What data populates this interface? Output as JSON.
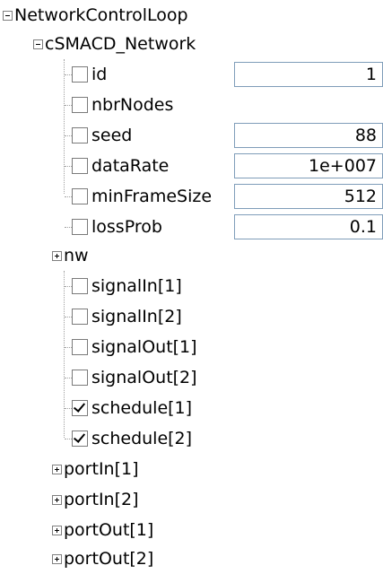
{
  "tree": {
    "root": {
      "label": "NetworkControlLoop",
      "expanded": true
    },
    "network": {
      "label": "cSMACD_Network",
      "expanded": true,
      "params": [
        {
          "label": "id",
          "value": "1",
          "checked": false
        },
        {
          "label": "nbrNodes",
          "value": "",
          "checked": false
        },
        {
          "label": "seed",
          "value": "88",
          "checked": false
        },
        {
          "label": "dataRate",
          "value": "1e+007",
          "checked": false
        },
        {
          "label": "minFrameSize",
          "value": "512",
          "checked": false
        },
        {
          "label": "lossProb",
          "value": "0.1",
          "checked": false
        }
      ],
      "nw": {
        "label": "nw",
        "expanded": false
      },
      "signals": [
        {
          "label": "signalIn[1]",
          "checked": false
        },
        {
          "label": "signalIn[2]",
          "checked": false
        },
        {
          "label": "signalOut[1]",
          "checked": false
        },
        {
          "label": "signalOut[2]",
          "checked": false
        },
        {
          "label": "schedule[1]",
          "checked": true
        },
        {
          "label": "schedule[2]",
          "checked": true
        }
      ],
      "ports": [
        {
          "label": "portIn[1]",
          "expanded": false
        },
        {
          "label": "portIn[2]",
          "expanded": false
        },
        {
          "label": "portOut[1]",
          "expanded": false
        },
        {
          "label": "portOut[2]",
          "expanded": false
        }
      ]
    }
  }
}
